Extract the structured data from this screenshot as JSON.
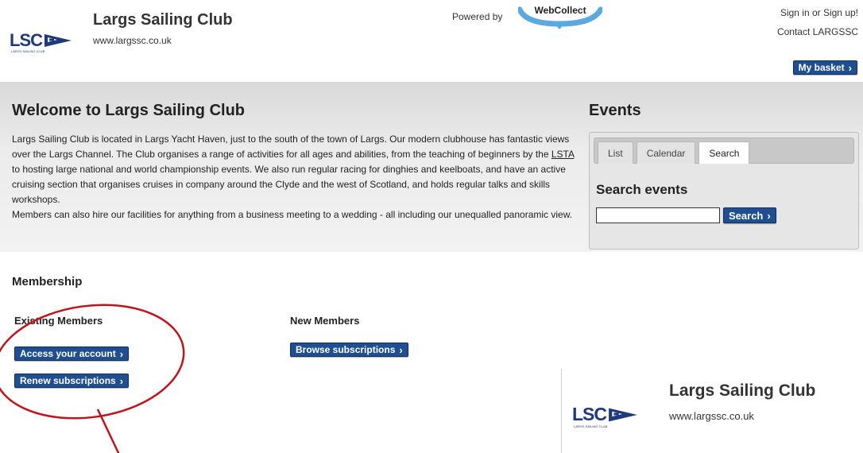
{
  "header": {
    "club_name": "Largs Sailing Club",
    "club_url": "www.largssc.co.uk",
    "logo_text": "LSC",
    "logo_sub": "LARGS SAILING CLUB",
    "powered_by": "Powered by",
    "webcollect": "WebCollect",
    "sign_in": "Sign in or Sign up!",
    "contact": "Contact LARGSSC",
    "basket": "My basket"
  },
  "welcome": {
    "title": "Welcome to Largs Sailing Club",
    "p1_before": "Largs Sailing Club is located in Largs Yacht Haven, just to the south of the town of Largs. Our modern clubhouse has fantastic views over the Largs Channel. The Club organises a range of activities for all ages and abilities, from the teaching of beginners by the ",
    "p1_link": "LSTA",
    "p1_after": " to hosting large national and world championship events. We also run regular racing for dinghies and keelboats, and have an active cruising section that organises cruises in company around the Clyde and the west of Scotland, and holds regular talks and skills workshops.",
    "p2": "Members can also hire our facilities for anything from a business meeting to a wedding - all including our unequalled panoramic view."
  },
  "events": {
    "title": "Events",
    "tabs": [
      "List",
      "Calendar",
      "Search"
    ],
    "active_tab": "Search",
    "search_title": "Search events",
    "search_value": "",
    "search_button": "Search"
  },
  "membership": {
    "title": "Membership",
    "existing_title": "Existing Members",
    "new_title": "New Members",
    "access_button": "Access your account",
    "renew_button": "Renew subscriptions",
    "browse_button": "Browse subscriptions"
  },
  "zoom": {
    "club_name": "Largs Sailing Club",
    "club_url": "www.largssc.co.uk",
    "logo_text": "LSC",
    "logo_sub": "LARGS SAILING CLUB"
  },
  "colors": {
    "button_bg": "#1f4f91",
    "annotation_red": "#c0141c",
    "logo_blue": "#1f3a7a",
    "webcollect_blue": "#5aa9e0"
  },
  "icons": [
    "chevron-right-icon",
    "sail-flag-icon"
  ]
}
